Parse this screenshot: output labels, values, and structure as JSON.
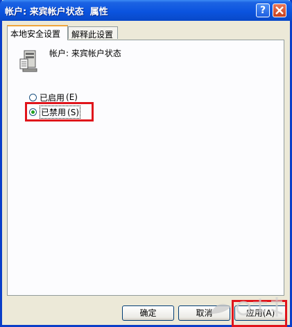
{
  "titlebar": {
    "title": "帐户: 来宾帐户状态  属性",
    "help_label": "?"
  },
  "tabs": [
    {
      "label": "本地安全设置"
    },
    {
      "label": "解释此设置"
    }
  ],
  "panel": {
    "setting_name": "帐户: 来宾帐户状态",
    "options": [
      {
        "label": "已启用",
        "accel": "(E)",
        "checked": false
      },
      {
        "label": "已禁用",
        "accel": "(S)",
        "checked": true
      }
    ]
  },
  "buttons": {
    "ok": "确定",
    "cancel": "取消",
    "apply": "应用",
    "apply_accel": "(A)"
  },
  "icons": [
    "server-settings-icon",
    "help-icon",
    "close-icon"
  ],
  "colors": {
    "highlight": "#e0141b",
    "titlebar": "#0b54df"
  }
}
